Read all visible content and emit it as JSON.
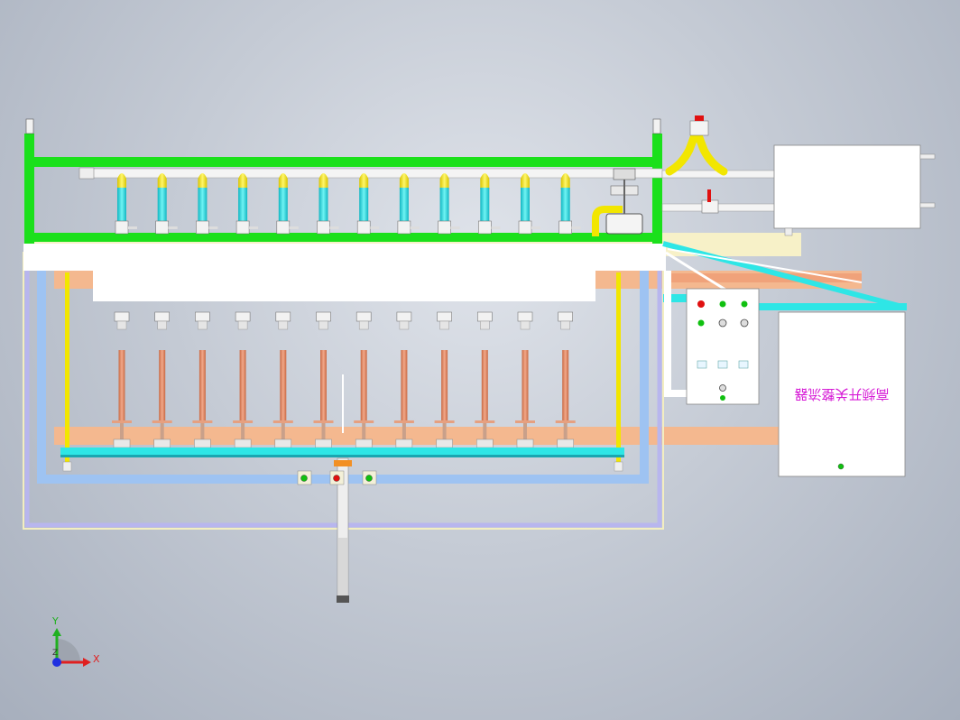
{
  "panel": {
    "label": "高频开关整流器",
    "text_rotation_deg": 180,
    "label_color": "#d61ad6"
  },
  "axis_triad": {
    "y_label": "Y",
    "x_label": "X",
    "z_label": "Z",
    "x_color": "#e02020",
    "y_color": "#20b020",
    "z_color": "#2030e0"
  },
  "controls": {
    "indicator_colors": [
      "#e01010",
      "#10c010",
      "#10c010",
      "#10c010"
    ]
  },
  "colors": {
    "frame_green": "#1be01b",
    "pipe_cyan": "#2ee6e6",
    "pipe_yellow": "#f2e600",
    "electrode_copper": "#e8906a",
    "tank_blue": "#9ec3f2",
    "slab_cream": "#f7f1c8",
    "rail_salmon": "#f4b88f"
  },
  "electrodes": {
    "count": 12
  }
}
